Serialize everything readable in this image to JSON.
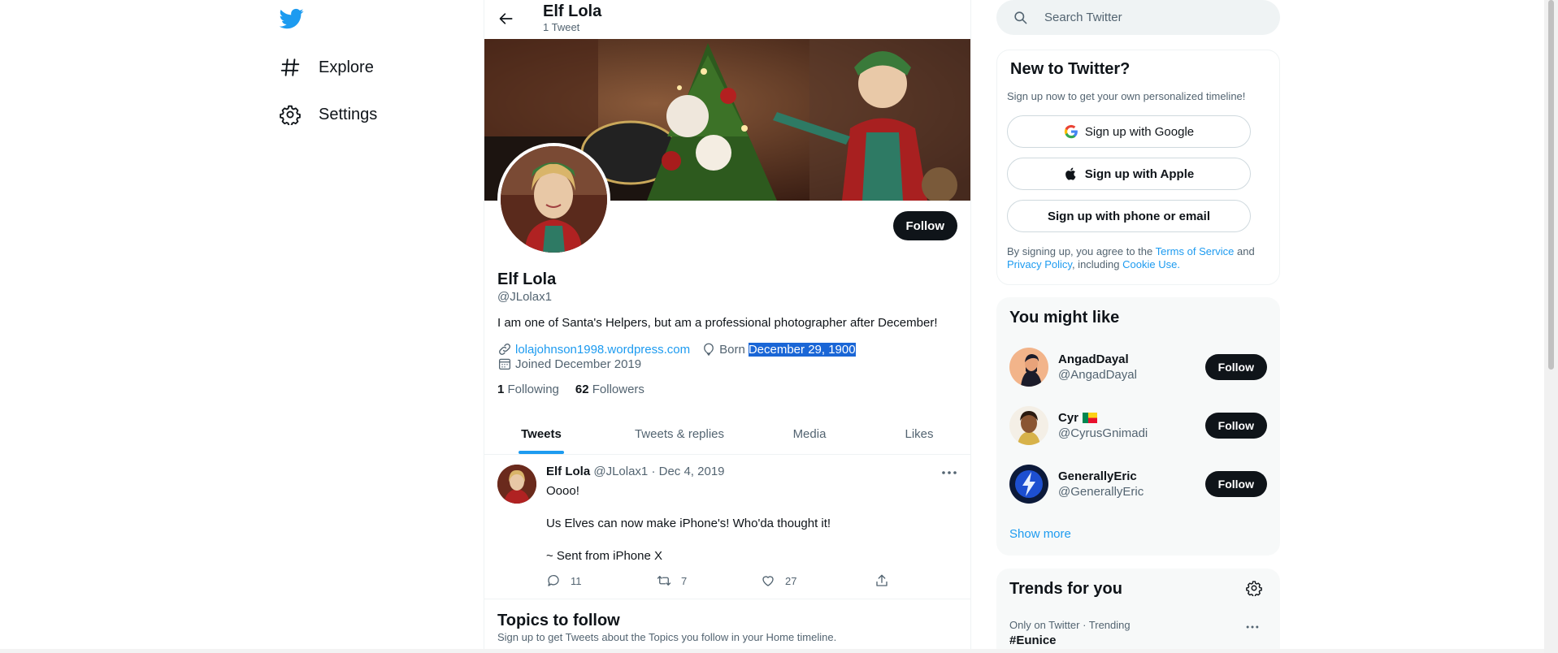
{
  "nav": {
    "explore_label": "Explore",
    "settings_label": "Settings"
  },
  "header": {
    "title": "Elf Lola",
    "subtitle": "1 Tweet"
  },
  "profile": {
    "follow_label": "Follow",
    "name": "Elf Lola",
    "handle": "@JLolax1",
    "bio": "I am one of Santa's Helpers, but am a professional photographer after December!",
    "website": "lolajohnson1998.wordpress.com",
    "born_prefix": "Born",
    "born_date": "December 29, 1900",
    "joined": "Joined December 2019",
    "following_count": "1",
    "following_label": "Following",
    "followers_count": "62",
    "followers_label": "Followers"
  },
  "tabs": [
    "Tweets",
    "Tweets & replies",
    "Media",
    "Likes"
  ],
  "tweet": {
    "name": "Elf Lola",
    "handle": "@JLolax1",
    "sep": "·",
    "date": "Dec 4, 2019",
    "line1": "Oooo!",
    "line2": "Us Elves can now make iPhone's! Who'da thought it!",
    "line3": "~ Sent from iPhone X",
    "replies": "11",
    "retweets": "7",
    "likes": "27"
  },
  "topics": {
    "title": "Topics to follow",
    "subtitle": "Sign up to get Tweets about the Topics you follow in your Home timeline."
  },
  "search": {
    "placeholder": "Search Twitter"
  },
  "signup": {
    "title": "New to Twitter?",
    "subtitle": "Sign up now to get your own personalized timeline!",
    "google": "Sign up with Google",
    "apple": "Sign up with Apple",
    "phone": "Sign up with phone or email",
    "terms_1": "By signing up, you agree to the ",
    "terms_link1": "Terms of Service",
    "terms_2": " and ",
    "terms_link2": "Privacy Policy",
    "terms_3": ", including ",
    "terms_link3": "Cookie Use",
    "terms_4": "."
  },
  "who_to_follow": {
    "title": "You might like",
    "people": [
      {
        "name": "AngadDayal",
        "handle": "@AngadDayal",
        "follow": "Follow"
      },
      {
        "name": "Cyr",
        "handle": "@CyrusGnimadi",
        "follow": "Follow"
      },
      {
        "name": "GenerallyEric",
        "handle": "@GenerallyEric",
        "follow": "Follow"
      }
    ],
    "show_more": "Show more"
  },
  "trends": {
    "title": "Trends for you",
    "item_meta": "Only on Twitter · Trending",
    "item_name": "#Eunice"
  },
  "colors": {
    "accent": "#1d9bf0",
    "text": "#0f1419",
    "secondary": "#536471",
    "button_dark": "#0f1419",
    "selection": "#1a66d6"
  },
  "icons": [
    "twitter-logo-icon",
    "hashtag-icon",
    "gear-icon",
    "back-arrow-icon",
    "link-icon",
    "balloon-icon",
    "calendar-icon",
    "reply-icon",
    "retweet-icon",
    "like-icon",
    "share-icon",
    "more-icon",
    "search-icon",
    "google-icon",
    "apple-icon"
  ]
}
